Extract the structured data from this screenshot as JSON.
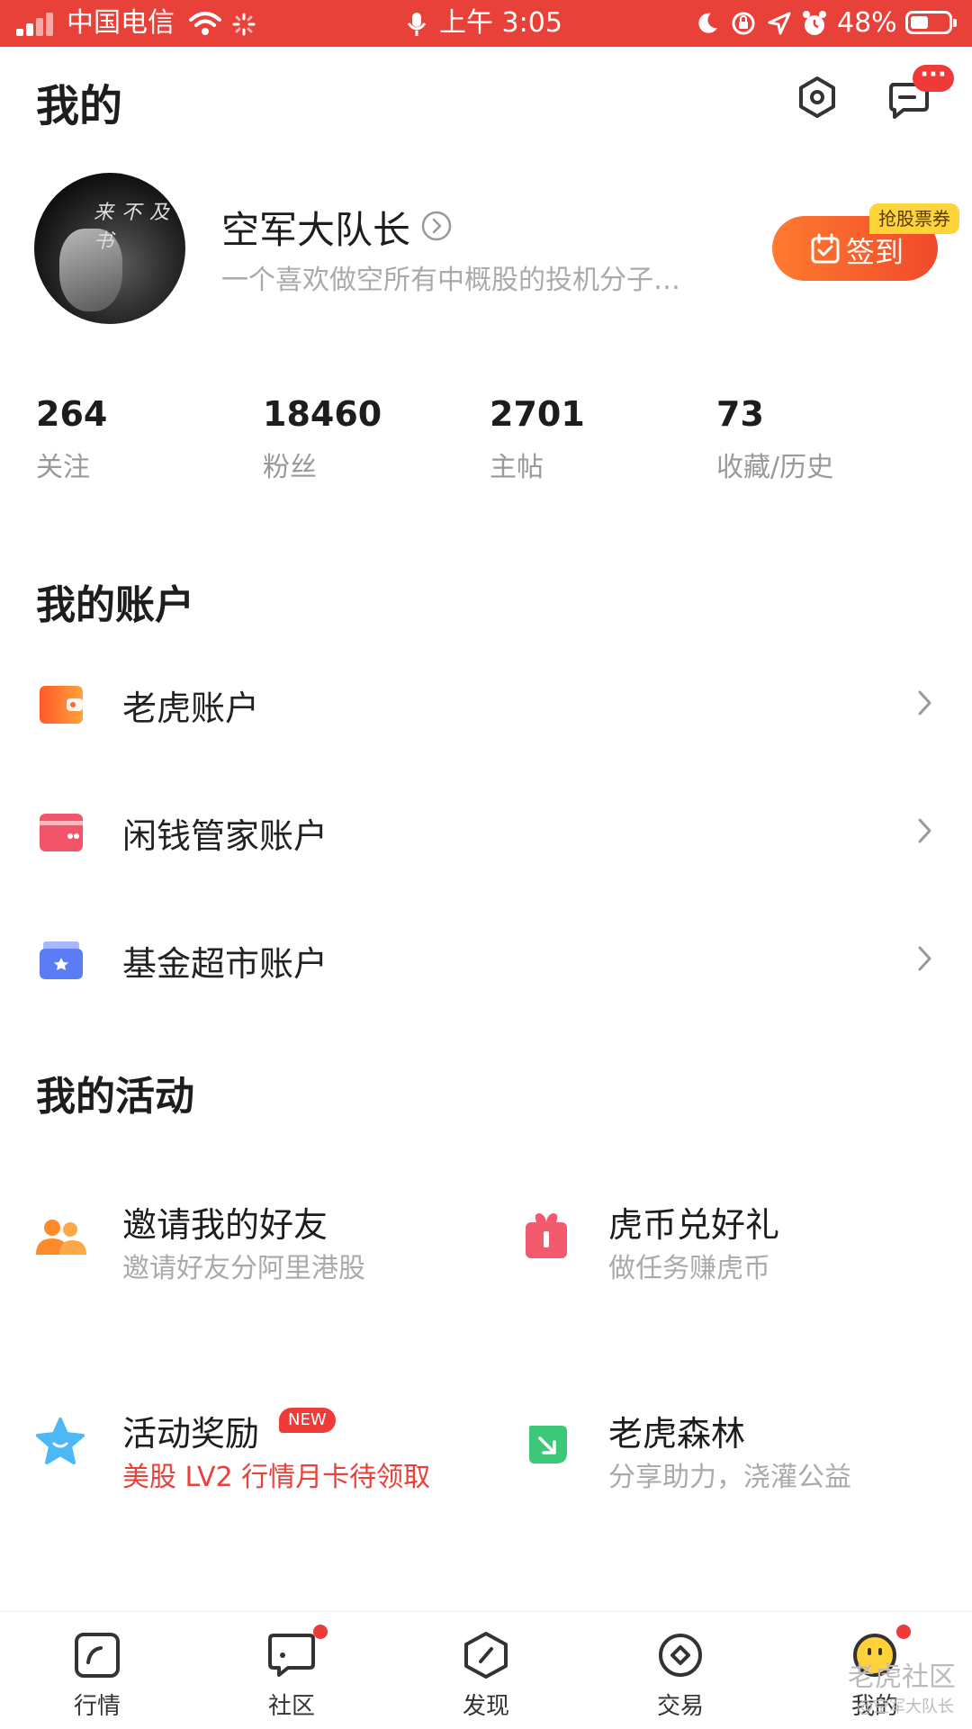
{
  "status_bar": {
    "carrier": "中国电信",
    "time": "上午 3:05",
    "battery": "48%",
    "battery_level": 0.48
  },
  "header": {
    "title": "我的"
  },
  "profile": {
    "username": "空军大队长",
    "bio": "一个喜欢做空所有中概股的投机分子…",
    "checkin_label": "签到",
    "checkin_badge": "抢股票券"
  },
  "stats": [
    {
      "value": "264",
      "label": "关注"
    },
    {
      "value": "18460",
      "label": "粉丝"
    },
    {
      "value": "2701",
      "label": "主帖"
    },
    {
      "value": "73",
      "label": "收藏/历史"
    }
  ],
  "accounts": {
    "title": "我的账户",
    "items": [
      {
        "label": "老虎账户",
        "icon": "wallet-icon",
        "color": "#ff6a2b"
      },
      {
        "label": "闲钱管家账户",
        "icon": "card-icon",
        "color": "#f2546a"
      },
      {
        "label": "基金超市账户",
        "icon": "fund-box-icon",
        "color": "#5b7cf5"
      }
    ]
  },
  "activities": {
    "title": "我的活动",
    "items": [
      {
        "title": "邀请我的好友",
        "subtitle": "邀请好友分阿里港股",
        "icon": "invite-friends-icon"
      },
      {
        "title": "虎币兑好礼",
        "subtitle": "做任务赚虎币",
        "icon": "gift-icon"
      },
      {
        "title": "活动奖励",
        "subtitle": "美股 LV2 行情月卡待领取",
        "badge": "NEW",
        "icon": "star-icon"
      },
      {
        "title": "老虎森林",
        "subtitle": "分享助力，浇灌公益",
        "icon": "leaf-icon"
      }
    ]
  },
  "tabbar": [
    {
      "label": "行情",
      "icon": "chart-icon"
    },
    {
      "label": "社区",
      "icon": "community-icon"
    },
    {
      "label": "发现",
      "icon": "compass-icon"
    },
    {
      "label": "交易",
      "icon": "trade-icon"
    },
    {
      "label": "我的",
      "icon": "profile-face-icon"
    }
  ],
  "watermark": {
    "brand": "老虎社区",
    "author": "@空军大队长"
  }
}
